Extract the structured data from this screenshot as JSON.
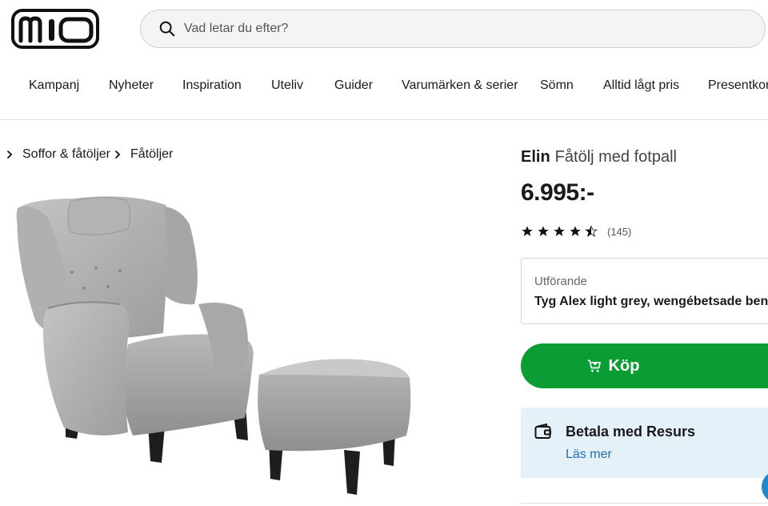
{
  "header": {
    "logo_text": "mio",
    "search_placeholder": "Vad letar du efter?"
  },
  "nav": {
    "items": [
      "Kampanj",
      "Nyheter",
      "Inspiration",
      "Uteliv",
      "Guider",
      "Varumärken & serier",
      "Sömn",
      "Alltid lågt pris",
      "Presentkort"
    ]
  },
  "breadcrumb": {
    "items": [
      "Soffor & fåtöljer",
      "Fåtöljer"
    ]
  },
  "product": {
    "brand": "Elin",
    "name": "Fåtölj med fotpall",
    "price": "6.995:-",
    "rating_value": 4.5,
    "rating_count": "(145)",
    "variant_label": "Utförande",
    "variant_value": "Tyg Alex light grey, wengébetsade ben",
    "buy_label": "Köp"
  },
  "payment": {
    "title": "Betala med Resurs",
    "link": "Läs mer"
  },
  "colors": {
    "buy_green": "#0b9d34",
    "payment_bg": "#e5f1f8",
    "link_blue": "#1f6fb2"
  }
}
